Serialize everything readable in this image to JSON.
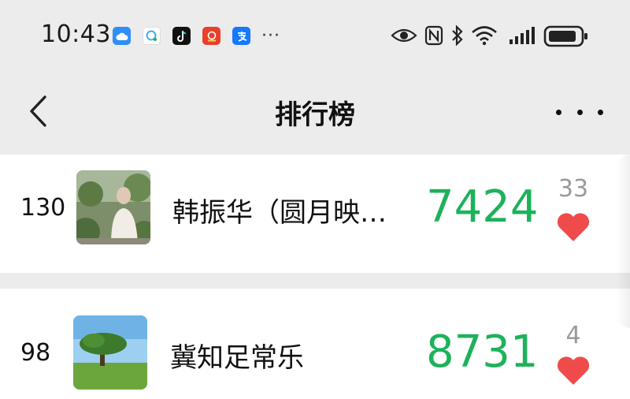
{
  "status_bar": {
    "time": "10:43",
    "more": "···",
    "app_icons": [
      "cloud-app-icon",
      "chat-app-icon",
      "tiktok-app-icon",
      "red-app-icon",
      "alipay-app-icon"
    ]
  },
  "header": {
    "title": "排行榜",
    "back_icon": "chevron-left-icon",
    "more_icon": "more-horizontal-icon"
  },
  "rankings": [
    {
      "rank": "130",
      "name": "韩振华（圆月映…",
      "steps": "7424",
      "likes": "33"
    },
    {
      "rank": "98",
      "name": "冀知足常乐",
      "steps": "8731",
      "likes": "4"
    }
  ],
  "colors": {
    "steps_green": "#1db25a",
    "heart_red": "#f04b4b",
    "like_gray": "#9a9a9a",
    "background": "#ececec"
  }
}
